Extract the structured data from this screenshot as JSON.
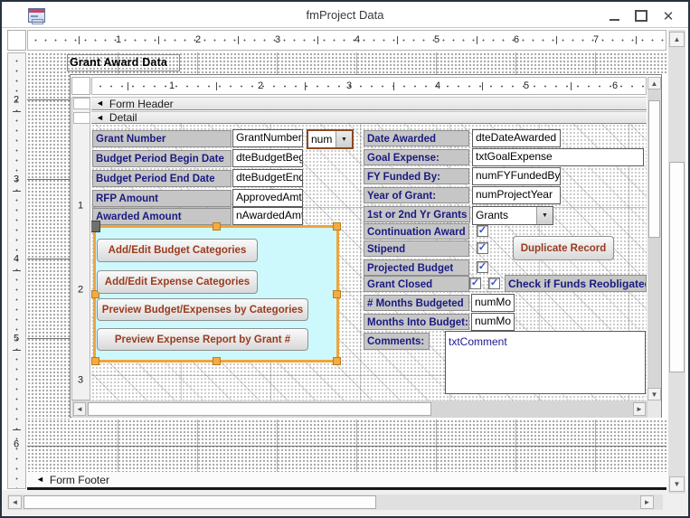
{
  "window": {
    "title": "fmProject Data"
  },
  "rulers": {
    "outer_h": [
      "1",
      "2",
      "3",
      "4",
      "5",
      "6",
      "7"
    ],
    "outer_v": [
      "2",
      "3",
      "4",
      "5",
      "6"
    ],
    "inner_h": [
      "1",
      "2",
      "3",
      "4",
      "5",
      "6"
    ],
    "inner_v": [
      "1",
      "2",
      "3"
    ]
  },
  "outer_form": {
    "subform_title_label": "Grant Award Data",
    "footer_section_label": "Form Footer"
  },
  "subform": {
    "header_section_label": "Form Header",
    "detail_section_label": "Detail",
    "left_fields": [
      {
        "label": "Grant Number",
        "value": "GrantNumber"
      },
      {
        "label": "Budget Period Begin Date",
        "value": "dteBudgetBeg"
      },
      {
        "label": "Budget Period End Date",
        "value": "dteBudgetEnd"
      },
      {
        "label": "RFP Amount",
        "value": "ApprovedAmt"
      },
      {
        "label": "Awarded Amount",
        "value": "nAwardedAmt"
      }
    ],
    "grant_number_combo": {
      "value": "num"
    },
    "right_fields": [
      {
        "label": "Date Awarded",
        "value": "dteDateAwarded"
      },
      {
        "label": "Goal Expense:",
        "value": "txtGoalExpense"
      },
      {
        "label": "FY Funded By:",
        "value": "numFYFundedBy"
      },
      {
        "label": "Year of Grant:",
        "value": "numProjectYear"
      }
    ],
    "year_combo": {
      "label": "1st or 2nd Yr Grants",
      "value": "Grants"
    },
    "check_rows": [
      {
        "label": "Continuation Award",
        "checked": true
      },
      {
        "label": "Stipend",
        "checked": true
      },
      {
        "label": "Projected Budget",
        "checked": true
      },
      {
        "label": "Grant Closed",
        "checked": true
      }
    ],
    "reobligated_checkbox_checked": true,
    "reobligated_label": "Check if Funds Reobligated",
    "months_fields": [
      {
        "label": "# Months Budgeted",
        "value": "numMo"
      },
      {
        "label": "Months Into Budget:",
        "value": "numMo"
      }
    ],
    "comments": {
      "label": "Comments:",
      "value": "txtComment"
    },
    "action_buttons": [
      "Add/Edit Budget Categories",
      "Add/Edit Expense Categories",
      "Preview Budget/Expenses by Categories",
      "Preview Expense Report by Grant #"
    ],
    "duplicate_button": "Duplicate Record"
  },
  "icons": {
    "check": "✓",
    "dropdown": "▼",
    "section_arrow": "◄",
    "scroll_up": "▲",
    "scroll_down": "▼",
    "scroll_left": "◄",
    "scroll_right": "►",
    "minimize": "–",
    "close": "✕"
  },
  "colors": {
    "label_text": "#1a1a80",
    "label_bg": "#c6c6c6",
    "button_text": "#9a3b1e",
    "highlight_fill": "#cdf8fc",
    "selection_orange": "#f0a43c",
    "check_blue": "#2b4fd4"
  }
}
